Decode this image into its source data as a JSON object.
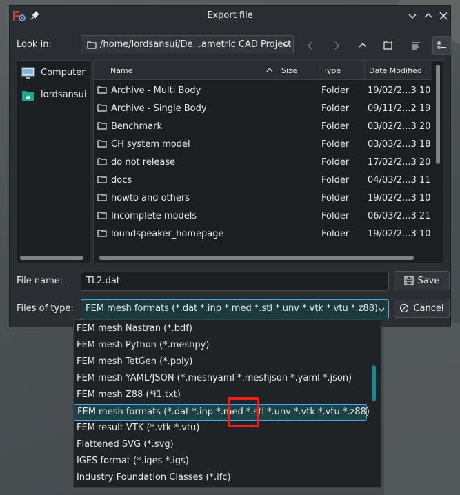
{
  "window": {
    "title": "Export file"
  },
  "lookin": {
    "label": "Look in:",
    "path": "/home/lordsansui/De...ametric CAD Project"
  },
  "places": [
    {
      "label": "Computer"
    },
    {
      "label": "lordsansui"
    }
  ],
  "columns": [
    "Name",
    "Size",
    "Type",
    "Date Modified"
  ],
  "files": [
    {
      "name": "Archive - Multi Body",
      "type": "Folder",
      "date": "19/02/2...3 10:0"
    },
    {
      "name": "Archive - Single Body",
      "type": "Folder",
      "date": "09/11/2...2 19:1"
    },
    {
      "name": "Benchmark",
      "type": "Folder",
      "date": "03/02/2...3 20:3"
    },
    {
      "name": "CH system model",
      "type": "Folder",
      "date": "03/03/2...3 18:1"
    },
    {
      "name": "do not release",
      "type": "Folder",
      "date": "17/02/2...3 20:4"
    },
    {
      "name": "docs",
      "type": "Folder",
      "date": "04/03/2...3 11:0"
    },
    {
      "name": "howto and others",
      "type": "Folder",
      "date": "19/02/2...3 10:3"
    },
    {
      "name": "Incomplete models",
      "type": "Folder",
      "date": "06/03/2...3 21:1"
    },
    {
      "name": "loundspeaker_homepage",
      "type": "Folder",
      "date": "19/02/2...3 10:3"
    }
  ],
  "filename": {
    "label": "File name:",
    "value": "TL2.dat"
  },
  "filetype": {
    "label": "Files of type:",
    "value": "FEM mesh formats (*.dat *.inp *.med *.stl *.unv *.vtk *.vtu *.z88)"
  },
  "buttons": {
    "save": "Save",
    "cancel": "Cancel"
  },
  "dropdown": [
    "FEM mesh Nastran (*.bdf)",
    "FEM mesh Python (*.meshpy)",
    "FEM mesh TetGen (*.poly)",
    "FEM mesh YAML/JSON (*.meshyaml *.meshjson *.yaml *.json)",
    "FEM mesh Z88 (*i1.txt)",
    "FEM mesh formats (*.dat *.inp *.med *.stl *.unv *.vtk *.vtu *.z88)",
    "FEM result VTK (*.vtk *.vtu)",
    "Flattened SVG (*.svg)",
    "IGES format (*.iges *.igs)",
    "Industry Foundation Classes (*.ifc)"
  ],
  "dropdown_selected_index": 5,
  "colors": {
    "accent": "#3daee9",
    "highlight_box": "#e8211b",
    "app_icon": "#d23a2e"
  }
}
